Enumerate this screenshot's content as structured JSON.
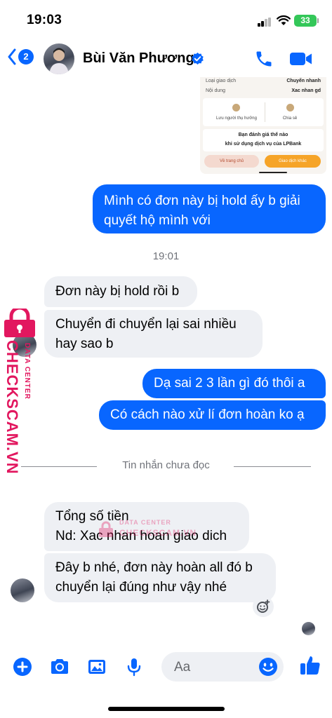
{
  "status_bar": {
    "time": "19:03",
    "battery": "33"
  },
  "header": {
    "back_count": "2",
    "contact_name": "Bùi Văn Phương"
  },
  "shared_image": {
    "rows": [
      {
        "label": "Loại giao dịch",
        "value": "Chuyển nhanh"
      },
      {
        "label": "Nội dung",
        "value": "Xac nhan gd"
      }
    ],
    "save_label": "Lưu người thụ hưởng",
    "share_label": "Chia sẻ",
    "rate_title": "Bạn đánh giá thế nào",
    "rate_sub": "khi sử dụng dịch vụ của LPBank",
    "home_btn": "Về trang chủ",
    "other_btn": "Giao dịch khác"
  },
  "messages": [
    {
      "text": "Mình có đơn này bị hold ấy b giải quyết hộ mình với"
    },
    {
      "text": "Đơn này bị hold rồi b"
    },
    {
      "text": "Chuyển đi chuyển lại sai nhiều hay sao b"
    },
    {
      "text": "Dạ sai 2 3 lần gì đó thôi a"
    },
    {
      "text": "Có cách nào xử lí đơn hoàn ko ạ"
    },
    {
      "text": "Tổng số tiền\nNd: Xac nhan hoan giao dich"
    },
    {
      "text": "Đây b nhé, đơn này hoàn all đó b chuyển lại đúng như vậy nhé"
    }
  ],
  "time_separator": "19:01",
  "unread_separator": "Tin nhắn chưa đọc",
  "watermark": {
    "brand": "CHECKSCAM.VN",
    "sub": "DATA CENTER"
  },
  "composer": {
    "placeholder": "Aa"
  },
  "colors": {
    "accent": "#0866ff",
    "incoming": "#eef0f4",
    "watermark": "#e2175f"
  },
  "icons": [
    "back-chevron-icon",
    "verified-badge-icon",
    "phone-icon",
    "video-camera-icon",
    "plus-icon",
    "camera-icon",
    "image-icon",
    "microphone-icon",
    "emoji-icon",
    "thumbs-up-icon",
    "add-reaction-icon",
    "lock-icon"
  ]
}
